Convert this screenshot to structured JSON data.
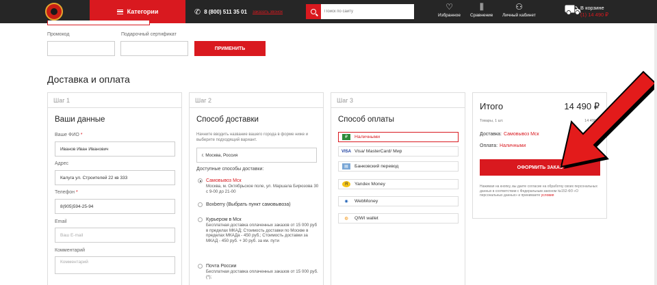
{
  "header": {
    "categories_label": "Категории",
    "phone": "8 (800) 511 35 01",
    "callback": "заказать звонок",
    "search_placeholder": "Поиск по сайту",
    "favorites": "Избранное",
    "compare": "Сравнение",
    "account": "Личный кабинет",
    "cart_title": "В корзине",
    "cart_sum": "(1) 14 490 ₽"
  },
  "promo": {
    "promo_label": "Промокод",
    "cert_label": "Подарочный сертификат",
    "apply_label": "ПРИМЕНИТЬ"
  },
  "section_title": "Доставка и оплата",
  "step1": {
    "step": "Шаг 1",
    "title": "Ваши данные",
    "name_label": "Ваше ФИО",
    "name_value": "Иванов Иван Иванович",
    "address_label": "Адрес",
    "address_value": "Калуга ул. Строителей 22 кв 333",
    "phone_label": "Телефон",
    "phone_value": "8(905)594-25-94",
    "email_label": "Email",
    "email_placeholder": "Ваш E-mail",
    "comment_label": "Комментарий",
    "comment_placeholder": "Комментарий",
    "required_mark": "*"
  },
  "step2": {
    "step": "Шаг 2",
    "title": "Способ доставки",
    "hint": "Начните вводить название вашего города в форме ниже и выберите подходящий вариант.",
    "city_value": "г. Москва, Россия",
    "available_label": "Доступные способы доставки:",
    "options": [
      {
        "title": "Самовывоз Мск",
        "desc": "Москва, м. Октябрьское поле, ул. Маршала Бирюзова 30 с 9-00 до 21-00"
      },
      {
        "title": "Boxberry (Выбрать пункт самовывоза)",
        "desc": ""
      },
      {
        "title": "Курьером в Мск",
        "desc": "Бесплатная доставка оплаченных заказов от 15 000 руб в пределах МКАД; Стоимость доставки по Москве в пределах МКАДа - 450 руб.; Стоимость доставки за МКАД - 450 руб. + 30 руб. за км. пути"
      },
      {
        "title": "Почта России",
        "desc": "Бесплатная доставка оплаченных заказов от 15 000 руб. (*);"
      }
    ]
  },
  "step3": {
    "step": "Шаг 3",
    "title": "Способ оплаты",
    "methods": [
      {
        "label": "Наличными",
        "icon": "cash-icon"
      },
      {
        "label": "Visa/ MasterCard/ Мир",
        "icon": "card-icon"
      },
      {
        "label": "Банковский перевод",
        "icon": "bank-icon"
      },
      {
        "label": "Yandex Money",
        "icon": "yandex-icon"
      },
      {
        "label": "WebMoney",
        "icon": "webmoney-icon"
      },
      {
        "label": "QIWI wallet",
        "icon": "qiwi-icon"
      }
    ]
  },
  "summary": {
    "title": "Итого",
    "total": "14 490 ₽",
    "goods_label": "Товары, 1 шт.",
    "goods_sum": "14 490 ₽",
    "delivery_label": "Доставка:",
    "delivery_value": "Самовывоз Мск",
    "payment_label": "Оплата:",
    "payment_value": "Наличными",
    "order_button": "ОФОРМИТЬ ЗАКАЗ",
    "legal_text": "Нажимая на кнопку, вы даете согласие на обработку своих персональных данных в соответствии с Федеральным законом №152-ФЗ «О персональных данных» и принимаете",
    "legal_link": "условия"
  },
  "colors": {
    "accent": "#d9191f",
    "header_bg": "#262626"
  }
}
